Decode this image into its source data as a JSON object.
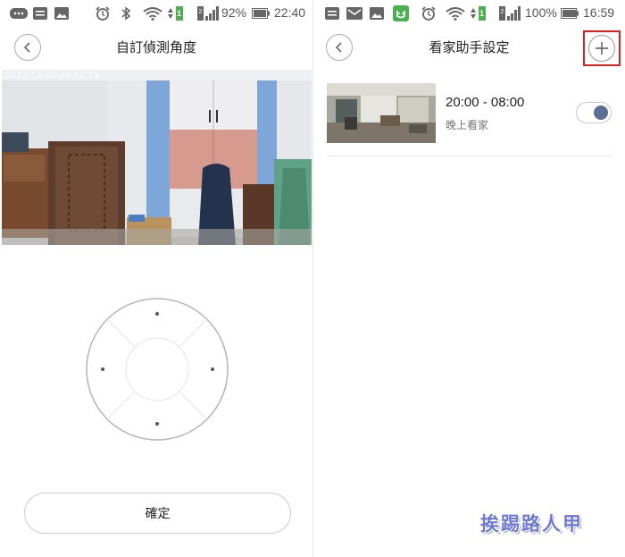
{
  "left": {
    "status": {
      "battery_percent": "92%",
      "time": "22:40",
      "wifi_badge": "1"
    },
    "title": "自訂偵測角度",
    "camera_timestamp": "2017-12-02 20:18:58",
    "confirm_label": "確定"
  },
  "right": {
    "status": {
      "battery_percent": "100%",
      "time": "16:59",
      "wifi_badge": "1"
    },
    "title": "看家助手設定",
    "schedule": [
      {
        "time": "20:00 - 08:00",
        "label": "晚上看家",
        "enabled": true
      }
    ]
  },
  "watermark": "挨踢路人甲",
  "colors": {
    "toggle_knob": "#5a6e96",
    "highlight_border": "#e02020",
    "watermark": "#6f78d8",
    "mi_icon": "#4caf50"
  }
}
